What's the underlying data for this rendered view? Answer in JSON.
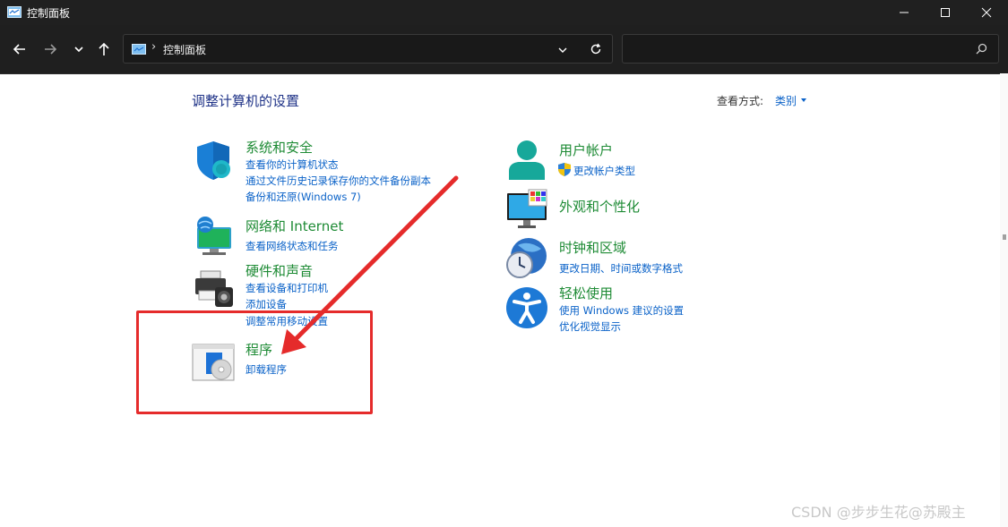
{
  "window": {
    "title": "控制面板"
  },
  "nav": {
    "breadcrumb": "控制面板",
    "search_placeholder": ""
  },
  "main": {
    "heading": "调整计算机的设置",
    "view_by_label": "查看方式:",
    "view_by_value": "类别",
    "categories": [
      {
        "title": "系统和安全",
        "links": [
          "查看你的计算机状态",
          "通过文件历史记录保存你的文件备份副本",
          "备份和还原(Windows 7)"
        ]
      },
      {
        "title": "网络和 Internet",
        "links": [
          "查看网络状态和任务"
        ]
      },
      {
        "title": "硬件和声音",
        "links": [
          "查看设备和打印机",
          "添加设备",
          "调整常用移动设置"
        ]
      },
      {
        "title": "程序",
        "links": [
          "卸载程序"
        ]
      },
      {
        "title": "用户帐户",
        "links": [
          "更改帐户类型"
        ]
      },
      {
        "title": "外观和个性化",
        "links": []
      },
      {
        "title": "时钟和区域",
        "links": [
          "更改日期、时间或数字格式"
        ]
      },
      {
        "title": "轻松使用",
        "links": [
          "使用 Windows 建议的设置",
          "优化视觉显示"
        ]
      }
    ]
  },
  "annotation": {
    "highlight_color": "#e52b2b"
  },
  "watermark": "CSDN @步步生花@苏殿主",
  "colors": {
    "title_bar": "#202020",
    "category_title": "#1e8b35",
    "link": "#0a62c8",
    "heading": "#1e3287"
  },
  "icons": [
    "control-panel-icon",
    "minimize-icon",
    "maximize-icon",
    "close-icon",
    "back-arrow-icon",
    "forward-arrow-icon",
    "chevron-down-icon",
    "up-arrow-icon",
    "refresh-icon",
    "search-icon",
    "shield-icon",
    "network-icon",
    "printer-icon",
    "programs-icon",
    "user-icon",
    "uac-shield-icon",
    "monitor-icon",
    "clock-globe-icon",
    "accessibility-icon"
  ]
}
